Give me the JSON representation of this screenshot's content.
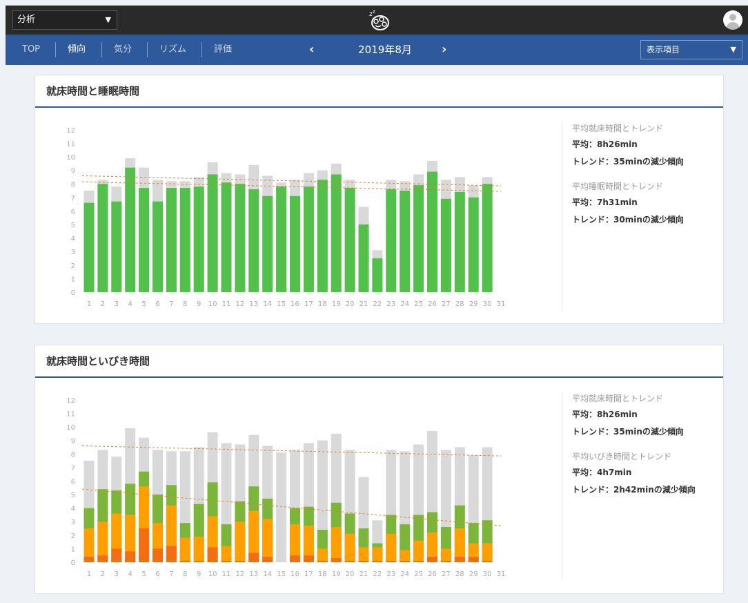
{
  "header": {
    "menu_select": "分析",
    "colors": {
      "topbar": "#2a2a2a",
      "navbar": "#2e5a9c"
    }
  },
  "nav": {
    "tabs": [
      "TOP",
      "傾向",
      "気分",
      "リズム",
      "評価"
    ],
    "active_tab": "傾向",
    "month": "2019年8月",
    "display_select": "表示項目"
  },
  "panel1": {
    "title": "就床時間と睡眠時間",
    "stats": {
      "bed_label": "平均就床時間とトレンド",
      "bed_avg": "平均：8h26min",
      "bed_trend": "トレンド：35minの減少傾向",
      "sleep_label": "平均睡眠時間とトレンド",
      "sleep_avg": "平均：7h31min",
      "sleep_trend": "トレンド：30minの減少傾向"
    }
  },
  "panel2": {
    "title": "就床時間といびき時間",
    "stats": {
      "bed_label": "平均就床時間とトレンド",
      "bed_avg": "平均：8h26min",
      "bed_trend": "トレンド：35minの減少傾向",
      "snore_label": "平均いびき時間とトレンド",
      "snore_avg": "平均：4h7min",
      "snore_trend": "トレンド：2h42minの減少傾向"
    }
  },
  "chart_data": [
    {
      "type": "bar",
      "title": "就床時間と睡眠時間",
      "x": [
        1,
        2,
        3,
        4,
        5,
        6,
        7,
        8,
        9,
        10,
        11,
        12,
        13,
        14,
        15,
        16,
        17,
        18,
        19,
        20,
        21,
        22,
        23,
        24,
        25,
        26,
        27,
        28,
        29,
        30,
        31
      ],
      "ylim": [
        0,
        12
      ],
      "yticks": [
        0,
        1,
        2,
        3,
        4,
        5,
        6,
        7,
        8,
        9,
        10,
        11,
        12
      ],
      "grid": false,
      "series": [
        {
          "color": "#d9d9d9",
          "values": [
            7.5,
            8.3,
            7.8,
            9.9,
            9.2,
            8.3,
            8.2,
            8.2,
            8.5,
            9.6,
            8.8,
            8.7,
            9.4,
            8.6,
            8.1,
            8.3,
            8.8,
            9.0,
            9.5,
            8.3,
            6.3,
            3.1,
            8.3,
            8.2,
            8.7,
            9.7,
            8.3,
            8.5,
            7.9,
            8.5,
            null
          ]
        },
        {
          "color": "#52c04a",
          "values": [
            6.6,
            8.0,
            6.7,
            9.2,
            7.7,
            6.7,
            7.7,
            7.7,
            7.8,
            8.7,
            8.1,
            8.0,
            7.6,
            7.1,
            7.8,
            7.1,
            7.8,
            8.3,
            8.7,
            7.7,
            5.0,
            2.5,
            7.6,
            7.5,
            7.9,
            8.9,
            6.9,
            7.4,
            7.0,
            8.0,
            null
          ]
        }
      ],
      "trendlines": [
        {
          "color": "#f07a2a",
          "from": [
            1,
            8.6
          ],
          "to": [
            31,
            7.85
          ]
        },
        {
          "color": "#f07a2a",
          "from": [
            1,
            8.15
          ],
          "to": [
            31,
            7.45
          ]
        }
      ]
    },
    {
      "type": "bar",
      "title": "就床時間といびき時間",
      "x": [
        1,
        2,
        3,
        4,
        5,
        6,
        7,
        8,
        9,
        10,
        11,
        12,
        13,
        14,
        15,
        16,
        17,
        18,
        19,
        20,
        21,
        22,
        23,
        24,
        25,
        26,
        27,
        28,
        29,
        30,
        31
      ],
      "ylim": [
        0,
        12
      ],
      "yticks": [
        0,
        1,
        2,
        3,
        4,
        5,
        6,
        7,
        8,
        9,
        10,
        11,
        12
      ],
      "grid": false,
      "layers": [
        {
          "color": "#d9d9d9",
          "values": [
            7.5,
            8.3,
            7.8,
            9.9,
            9.2,
            8.3,
            8.2,
            8.2,
            8.5,
            9.6,
            8.8,
            8.7,
            9.4,
            8.6,
            8.1,
            8.3,
            8.8,
            9.0,
            9.5,
            8.3,
            6.3,
            3.1,
            8.3,
            8.2,
            8.7,
            9.7,
            8.3,
            8.5,
            7.9,
            8.5,
            null
          ]
        },
        {
          "color": "#7bb63a",
          "values": [
            4.0,
            5.4,
            5.3,
            5.8,
            6.7,
            5.0,
            5.7,
            2.9,
            4.3,
            5.9,
            2.8,
            4.5,
            5.6,
            4.7,
            0,
            4.0,
            4.1,
            2.4,
            4.4,
            3.6,
            2.5,
            1.4,
            3.5,
            2.8,
            3.5,
            3.7,
            2.6,
            4.2,
            2.9,
            3.1,
            null
          ]
        },
        {
          "color": "#ffa000",
          "values": [
            2.5,
            3.0,
            3.6,
            3.5,
            5.6,
            2.9,
            4.2,
            1.8,
            1.9,
            3.4,
            1.2,
            3.0,
            3.8,
            3.2,
            0,
            2.8,
            2.7,
            1.0,
            2.6,
            2.1,
            1.1,
            1.1,
            2.1,
            0.9,
            1.6,
            2.2,
            1.0,
            2.5,
            1.4,
            1.4,
            null
          ]
        },
        {
          "color": "#f56d12",
          "values": [
            0.4,
            0.5,
            1.0,
            0.8,
            2.5,
            1.0,
            1.2,
            0.1,
            0.1,
            1.1,
            0.1,
            0.1,
            0.7,
            0.4,
            0,
            0.5,
            0.5,
            0.1,
            0.3,
            0.1,
            0.1,
            0.1,
            0.1,
            0.1,
            0.1,
            0.4,
            0.1,
            0.4,
            0.4,
            0.1,
            null
          ]
        }
      ],
      "trendlines": [
        {
          "color": "#f07a2a",
          "from": [
            1,
            8.6
          ],
          "to": [
            31,
            7.85
          ]
        },
        {
          "color": "#f07a2a",
          "from": [
            1,
            5.4
          ],
          "to": [
            31,
            2.7
          ]
        }
      ]
    }
  ]
}
